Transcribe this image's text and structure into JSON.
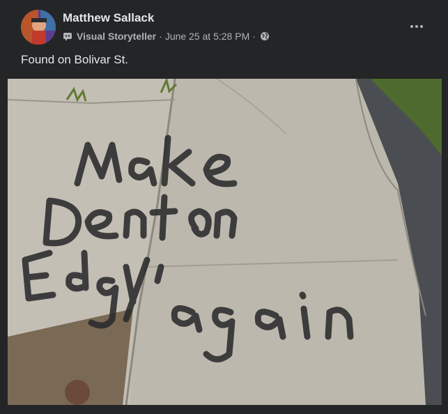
{
  "post": {
    "author": "Matthew Sallack",
    "badge_label": "Visual Storyteller",
    "separator": " · ",
    "timestamp": "June 25 at 5:28 PM",
    "privacy_separator": " · ",
    "text": "Found on Bolivar St.",
    "icons": {
      "badge": "storyteller-badge-icon",
      "privacy": "globe-icon",
      "menu": "more-options-icon"
    }
  },
  "photo": {
    "graffiti_text": [
      "Make",
      "Denton",
      "Edgy",
      "again"
    ]
  },
  "colors": {
    "card_bg": "#242526",
    "primary_text": "#e4e6eb",
    "secondary_text": "#b0b3b8"
  }
}
